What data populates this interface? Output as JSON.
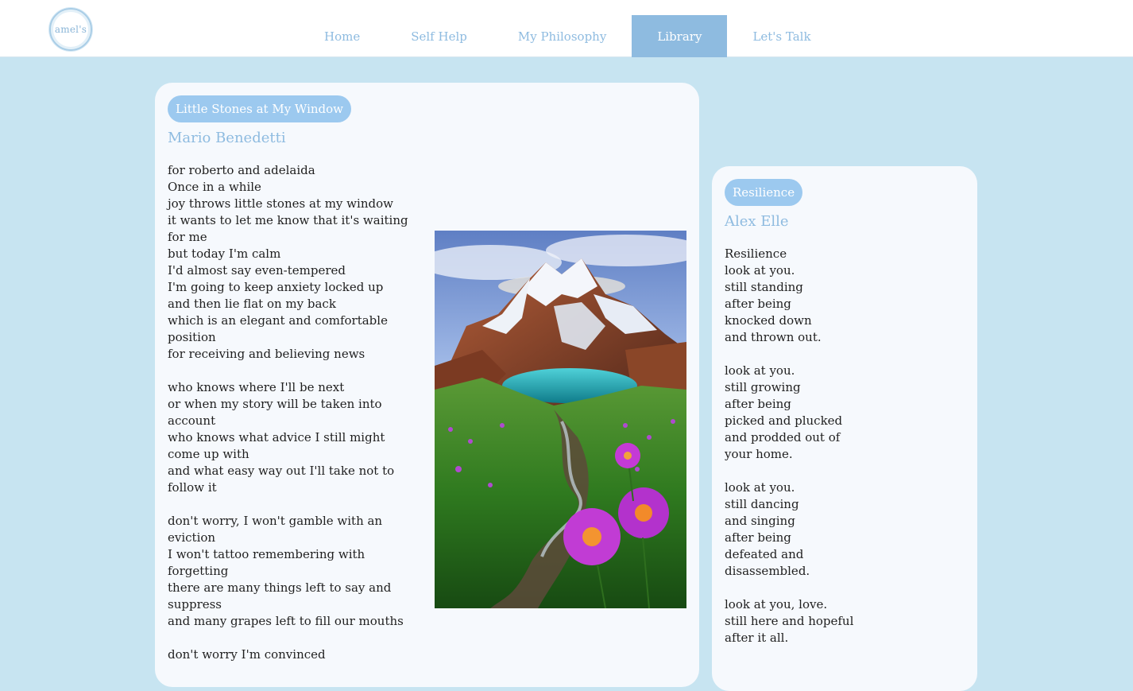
{
  "logo": {
    "text": "amel's"
  },
  "nav": {
    "items": [
      {
        "label": "Home",
        "active": false
      },
      {
        "label": "Self Help",
        "active": false
      },
      {
        "label": "My Philosophy",
        "active": false
      },
      {
        "label": "Library",
        "active": true
      },
      {
        "label": "Let's Talk",
        "active": false
      }
    ]
  },
  "colors": {
    "page_background": "#c7e4f1",
    "accent": "#8ebbe0",
    "pill": "#9cc9ef",
    "card": "#f6f9fd"
  },
  "poems": [
    {
      "title": "Little Stones at My Window",
      "author": "Mario Benedetti",
      "image": "mountain-lake-wildflowers-landscape",
      "lines": [
        "for roberto and adelaida",
        "Once in a while",
        "joy throws little stones at my window",
        "it wants to let me know that it's waiting for me",
        "but today I'm calm",
        "I'd almost say even-tempered",
        "I'm going to keep anxiety locked up",
        "and then lie flat on my back",
        "which is an elegant and comfortable position",
        "for receiving and believing news",
        "",
        "who knows where I'll be next",
        "or when my story will be taken into account",
        "who knows what advice I still might come up with",
        "and what easy way out I'll take not to follow it",
        "",
        "don't worry, I won't gamble with an eviction",
        "I won't tattoo remembering with forgetting",
        "there are many things left to say and suppress",
        "and many grapes left to fill our mouths",
        "",
        "don't worry I'm convinced"
      ]
    },
    {
      "title": "Resilience",
      "author": "Alex Elle",
      "lines": [
        "Resilience",
        "look at you.",
        "still standing",
        "after being",
        "knocked down",
        "and thrown out.",
        "",
        "look at you.",
        "still growing",
        "after being",
        "picked and plucked",
        "and prodded out of",
        "your home.",
        "",
        "look at you.",
        "still dancing",
        "and singing",
        "after being",
        "defeated and",
        "disassembled.",
        "",
        "look at you, love.",
        "still here and hopeful",
        "after it all."
      ]
    }
  ]
}
